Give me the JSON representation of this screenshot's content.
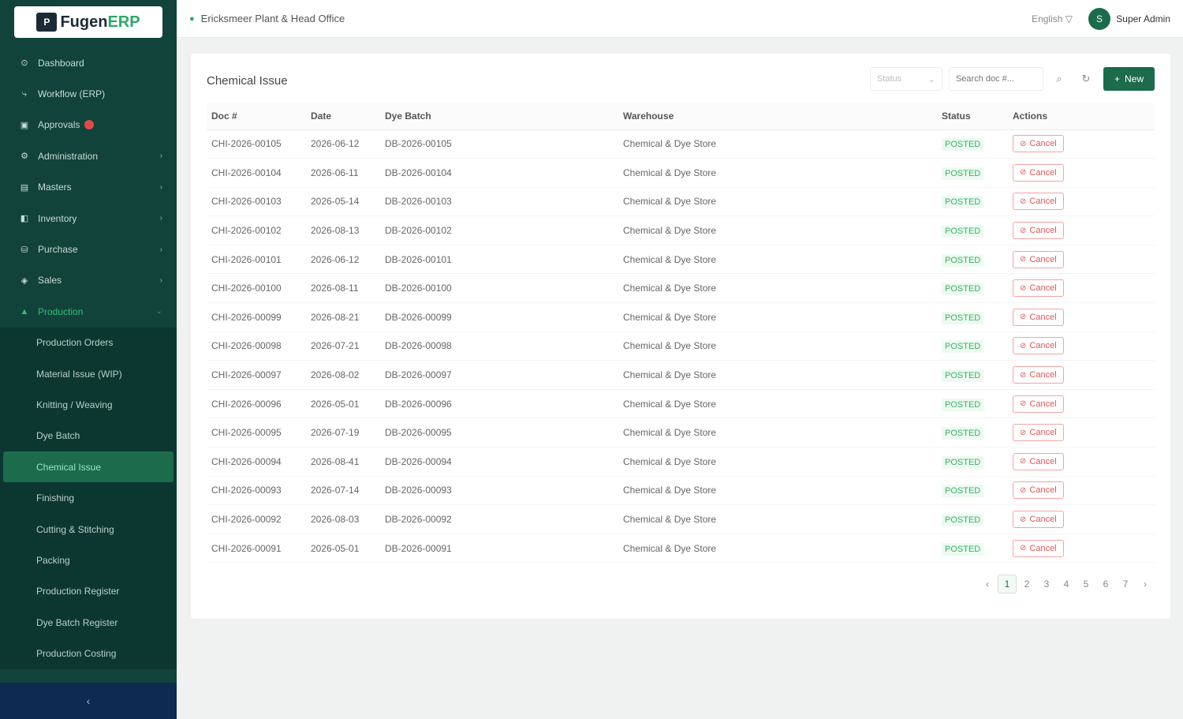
{
  "app": {
    "logo_mark": "P",
    "logo_text": "Fugen",
    "logo_text_accent": "ERP"
  },
  "sidebar": {
    "items": [
      {
        "label": "Dashboard",
        "icon": "⊙"
      },
      {
        "label": "Workflow (ERP)",
        "icon": "⤷"
      },
      {
        "label": "Approvals",
        "icon": "▣"
      },
      {
        "label": "Administration",
        "icon": "⚙"
      },
      {
        "label": "Masters",
        "icon": "▤"
      },
      {
        "label": "Inventory",
        "icon": "◧"
      },
      {
        "label": "Purchase",
        "icon": "⛁"
      },
      {
        "label": "Sales",
        "icon": "◈"
      },
      {
        "label": "Production",
        "icon": "▲"
      }
    ],
    "production_sub": [
      "Production Orders",
      "Material Issue (WIP)",
      "Knitting / Weaving",
      "Dye Batch",
      "Chemical Issue",
      "Finishing",
      "Cutting & Stitching",
      "Packing",
      "Production Register",
      "Dye Batch Register",
      "Production Costing"
    ],
    "collapse_icon": "‹"
  },
  "header": {
    "location": "Ericksmeer Plant & Head Office",
    "language": "English ▽",
    "avatar_initial": "S",
    "user": "Super Admin"
  },
  "page": {
    "title": "Chemical Issue",
    "status_filter_placeholder": "Status",
    "search_placeholder": "Search doc #...",
    "new_label": "New"
  },
  "table": {
    "columns": [
      "Doc #",
      "Date",
      "Dye Batch",
      "Warehouse",
      "Status",
      "Actions"
    ],
    "rows": [
      [
        "CHI-2026-00105",
        "2026-06-12",
        "DB-2026-00105",
        "Chemical & Dye Store",
        "POSTED",
        "Cancel"
      ],
      [
        "CHI-2026-00104",
        "2026-06-11",
        "DB-2026-00104",
        "Chemical & Dye Store",
        "POSTED",
        "Cancel"
      ],
      [
        "CHI-2026-00103",
        "2026-05-14",
        "DB-2026-00103",
        "Chemical & Dye Store",
        "POSTED",
        "Cancel"
      ],
      [
        "CHI-2026-00102",
        "2026-08-13",
        "DB-2026-00102",
        "Chemical & Dye Store",
        "POSTED",
        "Cancel"
      ],
      [
        "CHI-2026-00101",
        "2026-06-12",
        "DB-2026-00101",
        "Chemical & Dye Store",
        "POSTED",
        "Cancel"
      ],
      [
        "CHI-2026-00100",
        "2026-08-11",
        "DB-2026-00100",
        "Chemical & Dye Store",
        "POSTED",
        "Cancel"
      ],
      [
        "CHI-2026-00099",
        "2026-08-21",
        "DB-2026-00099",
        "Chemical & Dye Store",
        "POSTED",
        "Cancel"
      ],
      [
        "CHI-2026-00098",
        "2026-07-21",
        "DB-2026-00098",
        "Chemical & Dye Store",
        "POSTED",
        "Cancel"
      ],
      [
        "CHI-2026-00097",
        "2026-08-02",
        "DB-2026-00097",
        "Chemical & Dye Store",
        "POSTED",
        "Cancel"
      ],
      [
        "CHI-2026-00096",
        "2026-05-01",
        "DB-2026-00096",
        "Chemical & Dye Store",
        "POSTED",
        "Cancel"
      ],
      [
        "CHI-2026-00095",
        "2026-07-19",
        "DB-2026-00095",
        "Chemical & Dye Store",
        "POSTED",
        "Cancel"
      ],
      [
        "CHI-2026-00094",
        "2026-08-41",
        "DB-2026-00094",
        "Chemical & Dye Store",
        "POSTED",
        "Cancel"
      ],
      [
        "CHI-2026-00093",
        "2026-07-14",
        "DB-2026-00093",
        "Chemical & Dye Store",
        "POSTED",
        "Cancel"
      ],
      [
        "CHI-2026-00092",
        "2026-08-03",
        "DB-2026-00092",
        "Chemical & Dye Store",
        "POSTED",
        "Cancel"
      ],
      [
        "CHI-2026-00091",
        "2026-05-01",
        "DB-2026-00091",
        "Chemical & Dye Store",
        "POSTED",
        "Cancel"
      ]
    ]
  },
  "pagination": {
    "prev": "‹",
    "pages": [
      "1",
      "2",
      "3",
      "4",
      "5",
      "6",
      "7"
    ],
    "next": "›",
    "current": "1"
  },
  "colors": {
    "sidebar_bg": "#11433a",
    "accent": "#1c6b4b",
    "status_posted": "#36b463",
    "danger": "#e25555"
  }
}
